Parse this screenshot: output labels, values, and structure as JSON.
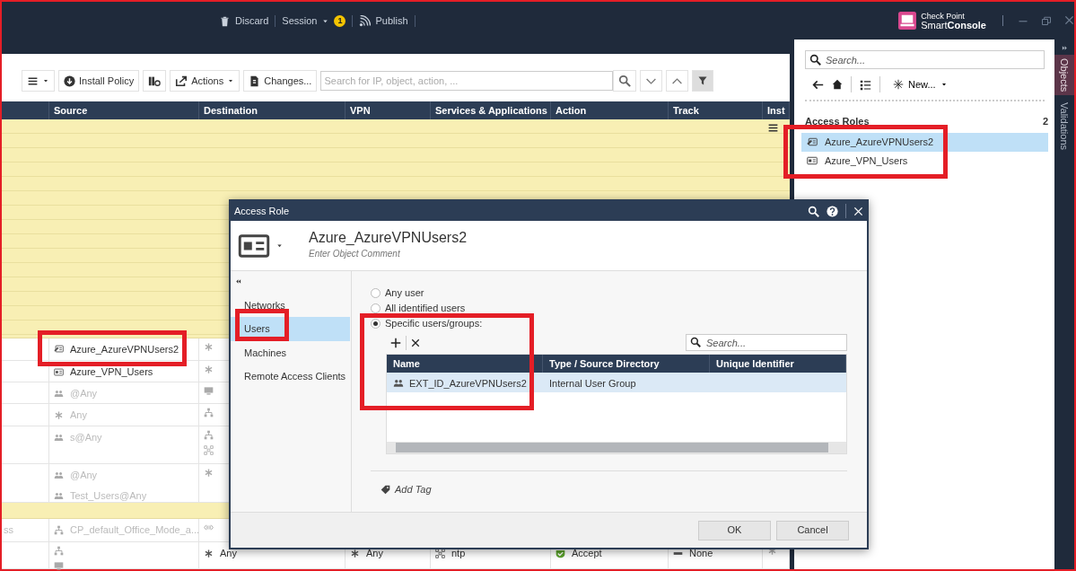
{
  "title_bar": {
    "actions": [
      {
        "kind": "discard",
        "label": "Discard"
      },
      {
        "kind": "session",
        "label": "Session",
        "badge": "1"
      },
      {
        "kind": "publish",
        "label": "Publish"
      }
    ],
    "logo": {
      "brand": "Check Point",
      "product": "Smart**Console**"
    }
  },
  "toolbar": {
    "buttons": [
      {
        "kind": "menu"
      },
      {
        "kind": "install",
        "label": "Install Policy"
      },
      {
        "kind": "layers"
      },
      {
        "kind": "actions",
        "label": "Actions"
      },
      {
        "kind": "changes",
        "label": "Changes..."
      }
    ],
    "search": {
      "placeholder": "Search for IP, object, action, ..."
    }
  },
  "policy_table": {
    "columns": [
      "Source",
      "Destination",
      "VPN",
      "Services & Applications",
      "Action",
      "Track",
      "Inst"
    ],
    "rows": [
      {
        "kind": "section"
      },
      {
        "kind": "rule",
        "source": [
          {
            "kind": "role-edit",
            "text": "Azure_AzureVPNUsers2",
            "disabled": false
          }
        ],
        "destination": [
          {
            "kind": "any"
          }
        ]
      },
      {
        "kind": "rule",
        "source": [
          {
            "kind": "role",
            "text": "Azure_VPN_Users",
            "disabled": false
          }
        ],
        "destination": [
          {
            "kind": "any"
          }
        ]
      },
      {
        "kind": "rule",
        "source": [
          {
            "kind": "group",
            "text": "@Any",
            "disabled": true
          }
        ],
        "destination": [
          {
            "kind": "monitor"
          }
        ]
      },
      {
        "kind": "rule",
        "source": [
          {
            "kind": "any",
            "text": "Any",
            "disabled": true
          }
        ],
        "destination": [
          {
            "kind": "network"
          }
        ]
      },
      {
        "kind": "rule",
        "source": [
          {
            "kind": "group",
            "text": "s@Any",
            "disabled": true
          }
        ],
        "destination": [
          {
            "kind": "network"
          },
          {
            "kind": "grid"
          }
        ]
      },
      {
        "kind": "rule",
        "source": [
          {
            "kind": "group",
            "text": "@Any",
            "disabled": true
          },
          {
            "kind": "group",
            "text": "Test_Users@Any",
            "disabled": true
          }
        ],
        "destination": [
          {
            "kind": "any"
          }
        ]
      },
      {
        "kind": "section"
      },
      {
        "kind": "rule",
        "column_1": "ss",
        "source": [
          {
            "kind": "network",
            "text": "CP_default_Office_Mode_a...",
            "disabled": true
          }
        ],
        "destination": [
          {
            "kind": "range"
          }
        ]
      },
      {
        "kind": "rule",
        "source": [
          {
            "kind": "network"
          },
          {
            "kind": "monitor"
          }
        ],
        "destination": [
          {
            "kind": "any",
            "text": "Any",
            "disabled": false
          }
        ],
        "vpn": [
          {
            "kind": "any",
            "text": "Any",
            "disabled": false
          }
        ],
        "services": [
          {
            "kind": "grid",
            "text": "ntp",
            "disabled": false
          }
        ],
        "action": [
          {
            "kind": "accept",
            "text": "Accept",
            "disabled": false
          }
        ],
        "track": [
          {
            "kind": "none",
            "text": "None",
            "disabled": false
          }
        ],
        "install_on": [
          {
            "kind": "any"
          }
        ]
      }
    ]
  },
  "dialog": {
    "title": "Access Role",
    "object_name": "Azure_AzureVPNUsers2",
    "comment": {
      "placeholder": "Enter Object Comment"
    },
    "nav": [
      {
        "label": "Networks",
        "selected": false
      },
      {
        "label": "Users",
        "selected": true
      },
      {
        "label": "Machines",
        "selected": false
      },
      {
        "label": "Remote Access Clients",
        "selected": false
      }
    ],
    "user_options": [
      {
        "label": "Any user",
        "selected": false
      },
      {
        "label": "All identified users",
        "selected": false
      },
      {
        "label": "Specific users/groups:",
        "selected": true
      }
    ],
    "search": {
      "placeholder": "Search..."
    },
    "members": {
      "columns": [
        "Name",
        "Type / Source Directory",
        "Unique Identifier"
      ],
      "rows": [
        {
          "name": "EXT_ID_AzureVPNUsers2",
          "type": "Internal User Group",
          "selected": true
        }
      ]
    },
    "add_tag": "Add Tag",
    "buttons": [
      "OK",
      "Cancel"
    ]
  },
  "objects_panel": {
    "search": {
      "placeholder": "Search..."
    },
    "new_label": "New...",
    "group": {
      "title": "Access Roles",
      "count": "2",
      "items": [
        {
          "kind": "role-edit",
          "label": "Azure_AzureVPNUsers2",
          "selected": true
        },
        {
          "kind": "role",
          "label": "Azure_VPN_Users",
          "selected": false
        }
      ]
    }
  },
  "side_tabs": [
    {
      "label": "Objects",
      "selected": true
    },
    {
      "label": "Validations",
      "selected": false
    }
  ]
}
